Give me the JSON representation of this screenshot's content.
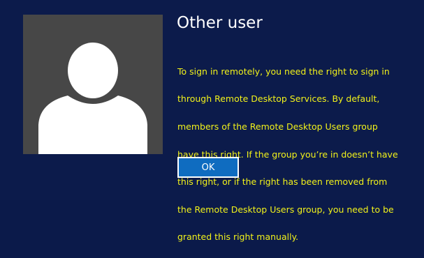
{
  "user": {
    "name": "Other user",
    "avatar_icon": "default-user-silhouette-icon"
  },
  "message": {
    "lines": [
      "To sign in remotely, you need the right to sign in",
      "through Remote Desktop Services. By default,",
      "members of the Remote Desktop Users group",
      "have this right. If the group you’re in doesn’t have",
      "this right, or if the right has been removed from",
      "the Remote Desktop Users group, you need to be",
      "granted this right manually."
    ]
  },
  "buttons": {
    "ok_label": "OK"
  },
  "colors": {
    "background": "#0c1b4b",
    "avatar_tile": "#474747",
    "message_text": "#f2f21a",
    "button_fill": "#0f6cc0",
    "button_border": "#ffffff"
  }
}
